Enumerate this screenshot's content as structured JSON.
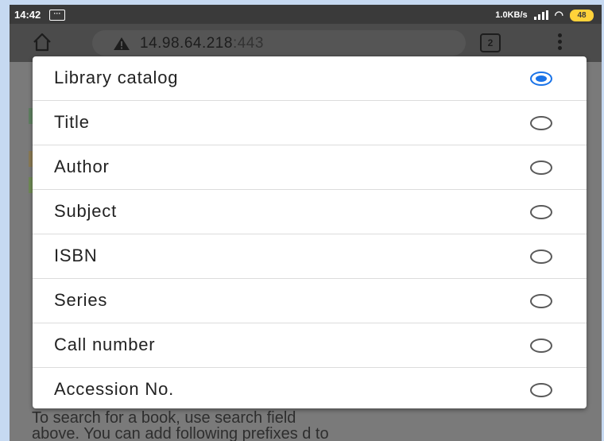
{
  "status_bar": {
    "time": "14:42",
    "notification_icon": "message-icon",
    "network_speed": "1.0KB/s",
    "battery": "48"
  },
  "browser": {
    "url_host": "14.98.64.218",
    "url_port": ":443",
    "tab_count": "2"
  },
  "dialog": {
    "options": [
      {
        "label": "Library catalog",
        "selected": true
      },
      {
        "label": "Title",
        "selected": false
      },
      {
        "label": "Author",
        "selected": false
      },
      {
        "label": "Subject",
        "selected": false
      },
      {
        "label": "ISBN",
        "selected": false
      },
      {
        "label": "Series",
        "selected": false
      },
      {
        "label": "Call number",
        "selected": false
      },
      {
        "label": "Accession No.",
        "selected": false
      }
    ]
  },
  "background_text": {
    "line1": "To search for a book, use search field",
    "line2": "above. You can add following prefixes d to"
  },
  "colors": {
    "accent": "#1a73e8",
    "background": "#c6d9f1"
  }
}
